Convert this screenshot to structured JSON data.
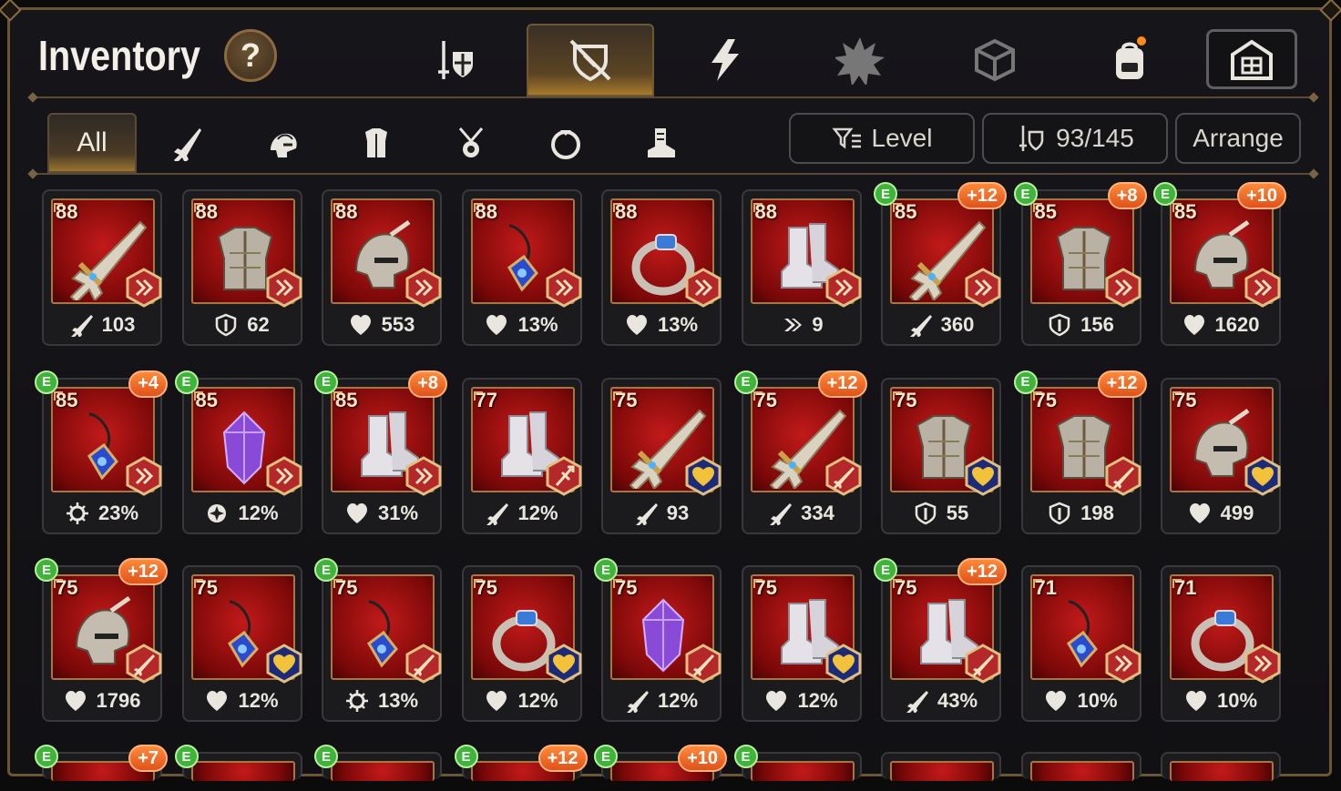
{
  "title": "Inventory",
  "help_label": "?",
  "category_tabs": [
    {
      "icon": "sword-shield-icon",
      "active": false
    },
    {
      "icon": "crossed-shield-icon",
      "active": true
    },
    {
      "icon": "lightning-icon",
      "active": false
    },
    {
      "icon": "burst-icon",
      "active": false
    },
    {
      "icon": "cube-icon",
      "active": false
    },
    {
      "icon": "backpack-icon",
      "active": false
    },
    {
      "icon": "vault-icon",
      "active": false
    }
  ],
  "filter_tabs": [
    {
      "label": "All",
      "icon": "",
      "active": true
    },
    {
      "label": "",
      "icon": "weapon-icon"
    },
    {
      "label": "",
      "icon": "helmet-icon"
    },
    {
      "label": "",
      "icon": "armor-icon"
    },
    {
      "label": "",
      "icon": "amulet-icon"
    },
    {
      "label": "",
      "icon": "ring-icon"
    },
    {
      "label": "",
      "icon": "boots-icon"
    }
  ],
  "sort": {
    "label": "Level"
  },
  "capacity": {
    "label": "93/145"
  },
  "arrange": {
    "label": "Arrange"
  },
  "colors": {
    "accent": "#a87a2c",
    "item_bg": "#c21a1a",
    "plus_badge": "#e0521a",
    "e_badge": "#3fb33a"
  },
  "items": [
    {
      "level": "88",
      "gear": "sword",
      "badge": "arrow",
      "stat_icon": "attack-icon",
      "stat": "103"
    },
    {
      "level": "88",
      "gear": "armor",
      "badge": "arrow",
      "stat_icon": "defense-icon",
      "stat": "62"
    },
    {
      "level": "88",
      "gear": "helmet",
      "badge": "arrow",
      "stat_icon": "hp-icon",
      "stat": "553"
    },
    {
      "level": "88",
      "gear": "amulet",
      "badge": "arrow",
      "stat_icon": "hp-icon",
      "stat": "13%"
    },
    {
      "level": "88",
      "gear": "ring",
      "badge": "arrow",
      "stat_icon": "hp-icon",
      "stat": "13%"
    },
    {
      "level": "88",
      "gear": "boots",
      "badge": "arrow",
      "stat_icon": "speed-icon",
      "stat": "9"
    },
    {
      "level": "85",
      "gear": "sword",
      "badge": "arrow",
      "stat_icon": "attack-icon",
      "stat": "360",
      "plus": "+12",
      "e": "E"
    },
    {
      "level": "85",
      "gear": "armor",
      "badge": "arrow",
      "stat_icon": "defense-icon",
      "stat": "156",
      "plus": "+8",
      "e": "E"
    },
    {
      "level": "85",
      "gear": "helmet",
      "badge": "arrow",
      "stat_icon": "hp-icon",
      "stat": "1620",
      "plus": "+10",
      "e": "E"
    },
    {
      "level": "85",
      "gear": "amulet",
      "badge": "arrow",
      "stat_icon": "crit-icon",
      "stat": "23%",
      "plus": "+4",
      "e": "E"
    },
    {
      "level": "85",
      "gear": "crystal",
      "badge": "arrow",
      "stat_icon": "accuracy-icon",
      "stat": "12%",
      "e": "E"
    },
    {
      "level": "85",
      "gear": "boots",
      "badge": "arrow",
      "stat_icon": "hp-icon",
      "stat": "31%",
      "plus": "+8",
      "e": "E"
    },
    {
      "level": "77",
      "gear": "boots",
      "badge": "trident",
      "stat_icon": "attack-icon",
      "stat": "12%"
    },
    {
      "level": "75",
      "gear": "sword",
      "badge": "heart",
      "stat_icon": "attack-icon",
      "stat": "93"
    },
    {
      "level": "75",
      "gear": "sword",
      "badge": "blade",
      "stat_icon": "attack-icon",
      "stat": "334",
      "plus": "+12",
      "e": "E"
    },
    {
      "level": "75",
      "gear": "armor",
      "badge": "heart",
      "stat_icon": "defense-icon",
      "stat": "55"
    },
    {
      "level": "75",
      "gear": "armor",
      "badge": "blade",
      "stat_icon": "defense-icon",
      "stat": "198",
      "plus": "+12",
      "e": "E"
    },
    {
      "level": "75",
      "gear": "helmet",
      "badge": "heart",
      "stat_icon": "hp-icon",
      "stat": "499"
    },
    {
      "level": "75",
      "gear": "helmet",
      "badge": "blade",
      "stat_icon": "hp-icon",
      "stat": "1796",
      "plus": "+12",
      "e": "E"
    },
    {
      "level": "75",
      "gear": "amulet",
      "badge": "heart",
      "stat_icon": "hp-icon",
      "stat": "12%"
    },
    {
      "level": "75",
      "gear": "amulet",
      "badge": "blade",
      "stat_icon": "crit-icon",
      "stat": "13%",
      "e": "E"
    },
    {
      "level": "75",
      "gear": "ring",
      "badge": "heart",
      "stat_icon": "hp-icon",
      "stat": "12%"
    },
    {
      "level": "75",
      "gear": "crystal",
      "badge": "blade",
      "stat_icon": "attack-icon",
      "stat": "12%",
      "e": "E"
    },
    {
      "level": "75",
      "gear": "boots",
      "badge": "heart",
      "stat_icon": "hp-icon",
      "stat": "12%"
    },
    {
      "level": "75",
      "gear": "boots",
      "badge": "blade",
      "stat_icon": "attack-icon",
      "stat": "43%",
      "plus": "+12",
      "e": "E"
    },
    {
      "level": "71",
      "gear": "amulet",
      "badge": "arrow",
      "stat_icon": "hp-icon",
      "stat": "10%"
    },
    {
      "level": "71",
      "gear": "ring",
      "badge": "arrow",
      "stat_icon": "hp-icon",
      "stat": "10%"
    }
  ],
  "partial_items": [
    {
      "plus": "+7",
      "e": "E"
    },
    {
      "e": "E"
    },
    {
      "e": "E"
    },
    {
      "plus": "+12",
      "e": "E"
    },
    {
      "plus": "+10",
      "e": "E"
    },
    {
      "e": "E"
    },
    {},
    {},
    {}
  ]
}
